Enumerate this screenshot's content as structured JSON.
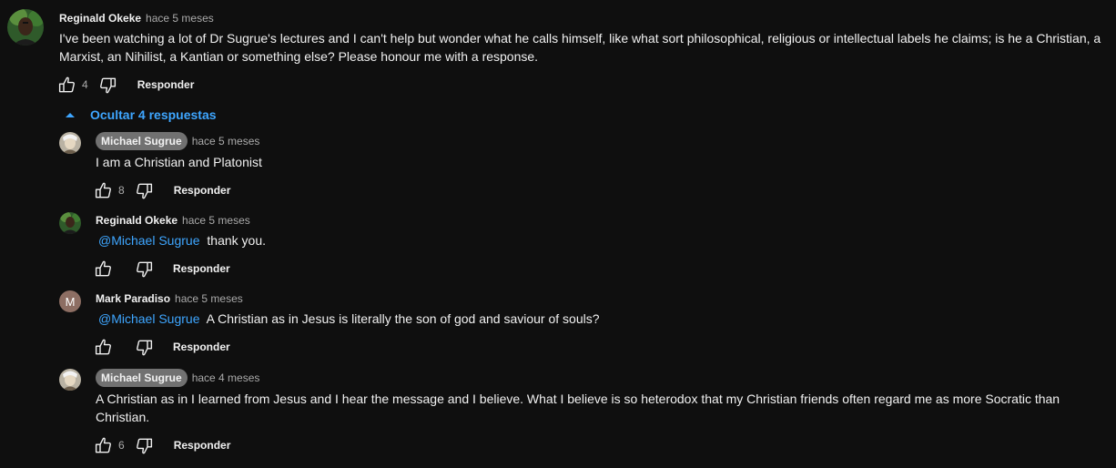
{
  "top_comment": {
    "author": "Reginald Okeke",
    "time": "hace 5 meses",
    "text": "I've been watching a lot of Dr Sugrue's lectures and I can't help but wonder what he calls himself, like what sort philosophical, religious or intellectual labels he claims; is he a Christian, a Marxist, an Nihilist, a Kantian or something else? Please honour me with a response.",
    "likes": "4",
    "reply_label": "Responder"
  },
  "replies_toggle": {
    "label": "Ocultar 4 respuestas"
  },
  "replies": [
    {
      "author": "Michael Sugrue",
      "time": "hace 5 meses",
      "mention": "",
      "text": "I am a Christian and Platonist",
      "likes": "8",
      "reply_label": "Responder"
    },
    {
      "author": "Reginald Okeke",
      "time": "hace 5 meses",
      "mention": "@Michael Sugrue",
      "text": "thank you.",
      "likes": "",
      "reply_label": "Responder"
    },
    {
      "author": "Mark Paradiso",
      "time": "hace 5 meses",
      "avatar_letter": "M",
      "mention": "@Michael Sugrue",
      "text": "A Christian as in Jesus is literally the son of god and saviour of souls?",
      "likes": "",
      "reply_label": "Responder"
    },
    {
      "author": "Michael Sugrue",
      "time": "hace 4 meses",
      "mention": "",
      "text": "A Christian as in I learned from Jesus and I hear the message and I believe. What I believe is so heterodox that my Christian friends often regard me as more Socratic than Christian.",
      "likes": "6",
      "reply_label": "Responder"
    }
  ],
  "icons": {
    "like": "thumbs-up-icon",
    "dislike": "thumbs-down-icon",
    "toggle": "caret-up-icon"
  },
  "colors": {
    "background": "#0f0f0f",
    "link": "#3ea6ff",
    "muted": "#aaaaaa",
    "owner_chip": "#717171",
    "mark_avatar": "#8d6e63"
  }
}
